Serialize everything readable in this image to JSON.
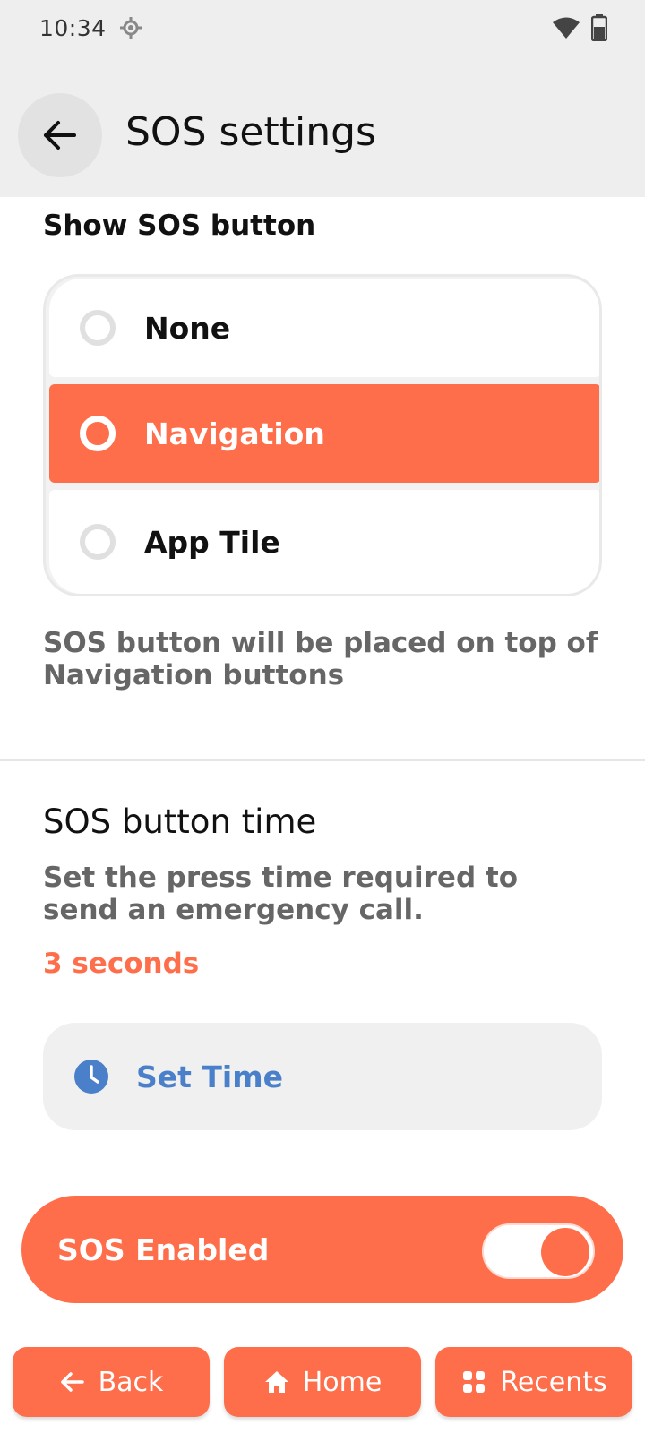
{
  "status_bar": {
    "time": "10:34"
  },
  "header": {
    "title": "SOS settings"
  },
  "show_sos": {
    "label": "Show SOS button",
    "options": [
      {
        "label": "None",
        "selected": false
      },
      {
        "label": "Navigation",
        "selected": true
      },
      {
        "label": "App Tile",
        "selected": false
      }
    ],
    "helper": "SOS button will be placed on top of Navigation buttons"
  },
  "sos_time": {
    "title": "SOS button time",
    "description": "Set the press time required to send an emergency call.",
    "value": "3 seconds",
    "set_time_label": "Set Time"
  },
  "sos_toggle": {
    "label": "SOS Enabled",
    "enabled": true
  },
  "bottom_nav": {
    "back": "Back",
    "home": "Home",
    "recents": "Recents"
  },
  "colors": {
    "accent": "#ff6e4a",
    "link_blue": "#4a7fc9",
    "header_bg": "#eeeeee"
  }
}
